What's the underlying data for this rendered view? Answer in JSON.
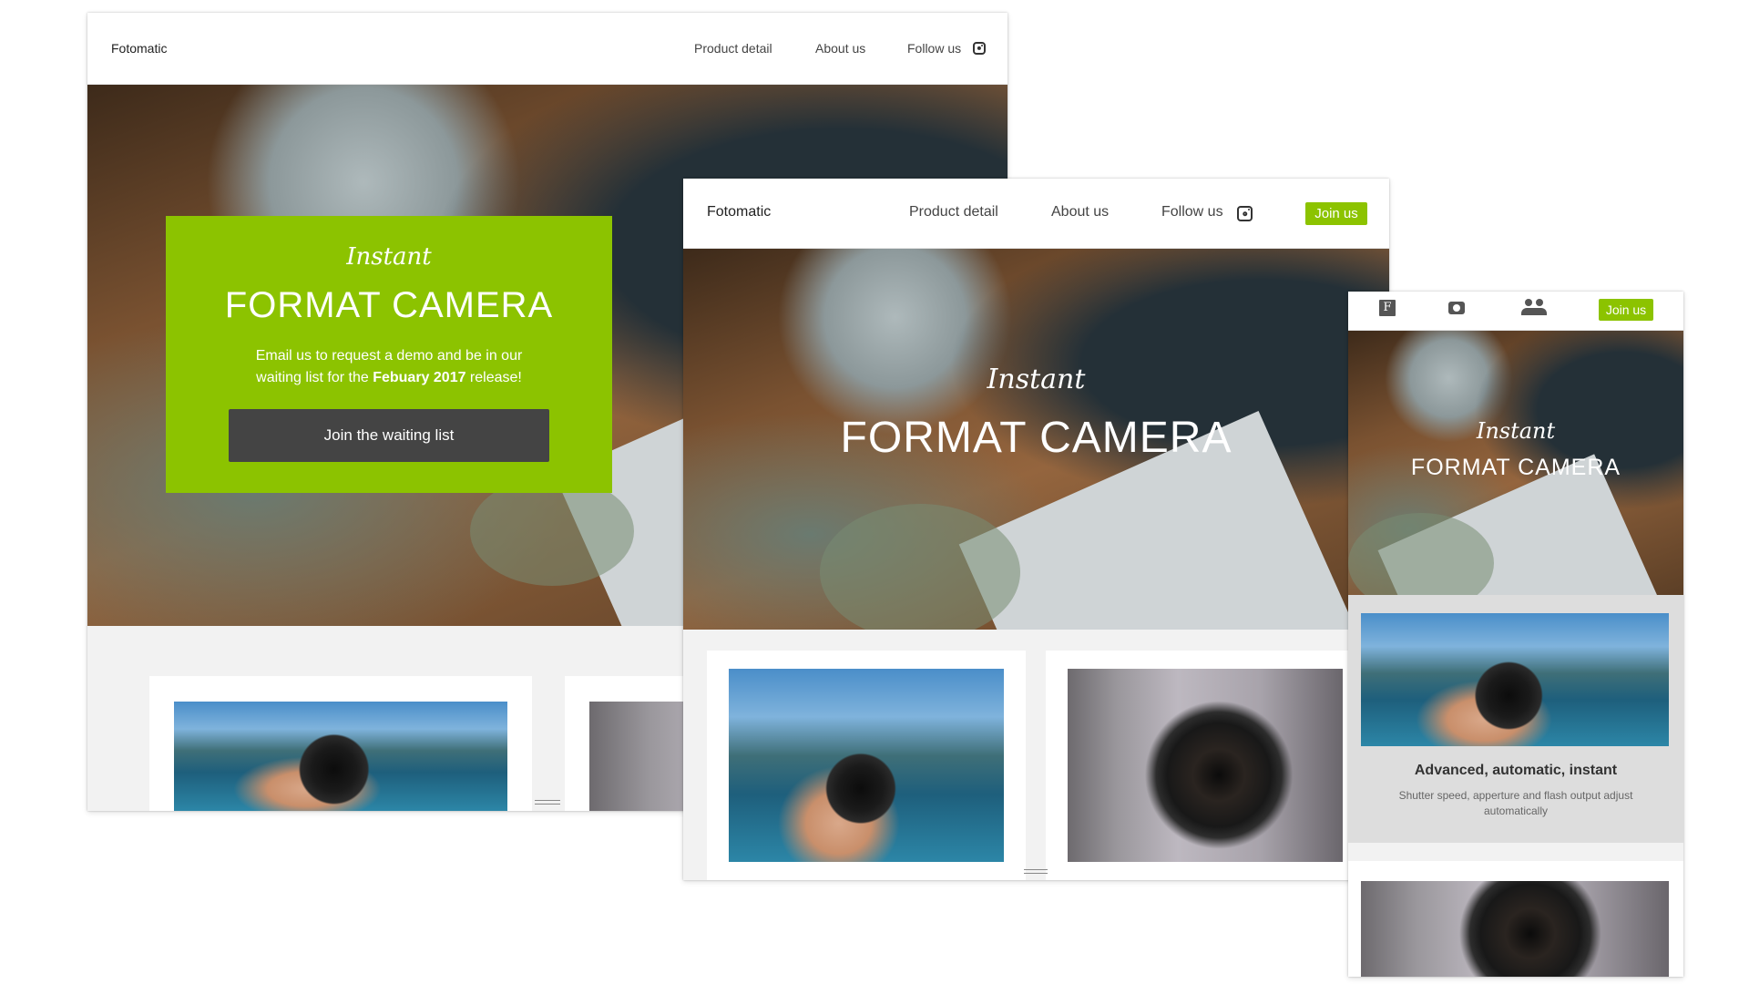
{
  "desktop": {
    "nav": {
      "brand": "Fotomatic",
      "links": [
        "Product detail",
        "About us",
        "Follow us"
      ],
      "social_icon": "instagram-icon"
    },
    "hero": {
      "script_title": "Instant",
      "title": "FORMAT CAMERA",
      "body_prefix": "Email us to request a demo and be in our waiting list for the ",
      "body_bold": "Febuary 2017",
      "body_suffix": " release!",
      "cta_label": "Join the waiting list"
    }
  },
  "tablet": {
    "nav": {
      "brand": "Fotomatic",
      "links": [
        "Product detail",
        "About us",
        "Follow us"
      ],
      "social_icon": "instagram-icon",
      "join_label": "Join us"
    },
    "hero": {
      "script_title": "Instant",
      "title": "FORMAT CAMERA"
    }
  },
  "mobile": {
    "nav": {
      "icons": [
        "fotomatic-logo-icon",
        "camera-icon",
        "people-icon"
      ],
      "logo_letter": "F",
      "join_label": "Join us"
    },
    "hero": {
      "script_title": "Instant",
      "title": "FORMAT CAMERA"
    },
    "feature": {
      "title": "Advanced, automatic, instant",
      "text": "Shutter speed, apperture and flash output adjust automatically"
    }
  },
  "colors": {
    "accent_green": "#8cc300",
    "cta_dark": "#444444",
    "section_bg": "#f2f2f2",
    "feature_bg": "#dddddd"
  }
}
